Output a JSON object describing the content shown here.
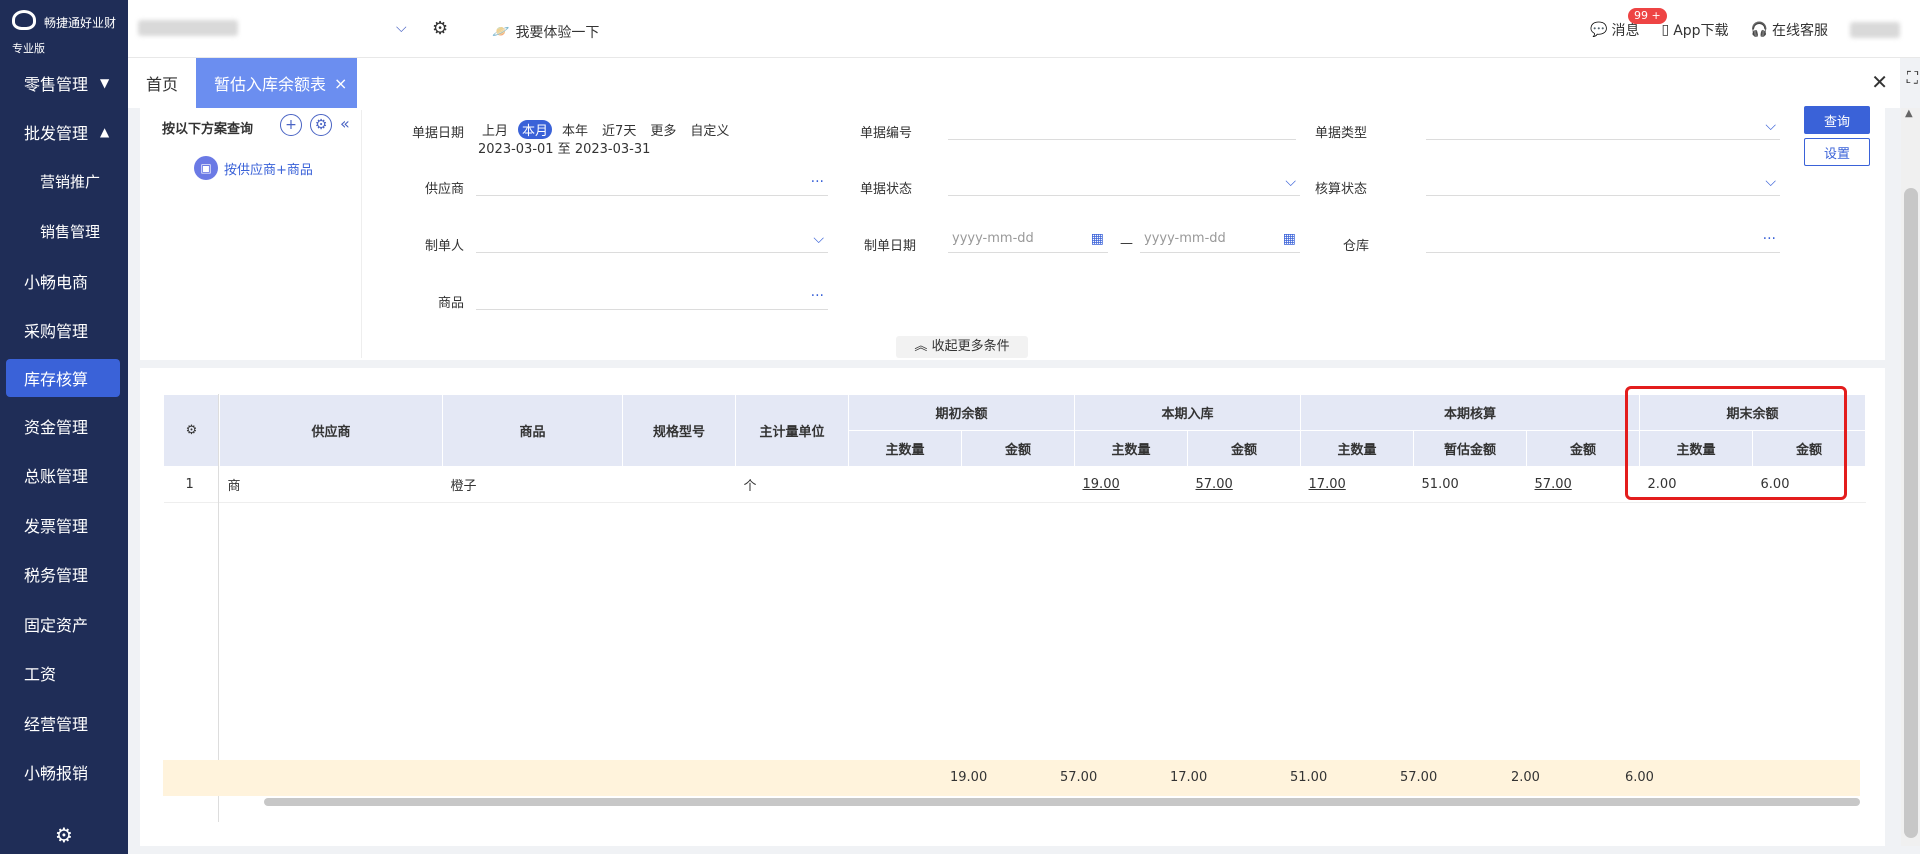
{
  "app": {
    "name": "畅捷通好业财",
    "edition": "专业版"
  },
  "sidebar": {
    "items": [
      {
        "label": "零售管理",
        "arrow": "▼",
        "sub": false,
        "active": false
      },
      {
        "label": "批发管理",
        "arrow": "▲",
        "sub": false,
        "active": false
      },
      {
        "label": "营销推广",
        "arrow": "",
        "sub": true,
        "active": false
      },
      {
        "label": "销售管理",
        "arrow": "",
        "sub": true,
        "active": false
      },
      {
        "label": "小畅电商",
        "arrow": "",
        "sub": false,
        "active": false
      },
      {
        "label": "采购管理",
        "arrow": "",
        "sub": false,
        "active": false
      },
      {
        "label": "库存核算",
        "arrow": "",
        "sub": false,
        "active": true
      },
      {
        "label": "资金管理",
        "arrow": "",
        "sub": false,
        "active": false
      },
      {
        "label": "总账管理",
        "arrow": "",
        "sub": false,
        "active": false
      },
      {
        "label": "发票管理",
        "arrow": "",
        "sub": false,
        "active": false
      },
      {
        "label": "税务管理",
        "arrow": "",
        "sub": false,
        "active": false
      },
      {
        "label": "固定资产",
        "arrow": "",
        "sub": false,
        "active": false
      },
      {
        "label": "工资",
        "arrow": "",
        "sub": false,
        "active": false
      },
      {
        "label": "经营管理",
        "arrow": "",
        "sub": false,
        "active": false
      },
      {
        "label": "小畅报销",
        "arrow": "",
        "sub": false,
        "active": false
      }
    ]
  },
  "topbar": {
    "try_label": "我要体验一下",
    "messages_label": "消息",
    "messages_badge": "99 +",
    "app_download_label": "App下载",
    "online_service_label": "在线客服"
  },
  "tabs": [
    {
      "label": "首页",
      "active": false
    },
    {
      "label": "暂估入库余额表",
      "active": true
    }
  ],
  "filters": {
    "panel_title": "按以下方案查询",
    "scheme_label": "按供应商+商品",
    "doc_date_label": "单据日期",
    "date_tags": [
      "上月",
      "本月",
      "本年",
      "近7天",
      "更多",
      "自定义"
    ],
    "date_active_index": 1,
    "date_range": "2023-03-01 至 2023-03-31",
    "doc_number_label": "单据编号",
    "doc_type_label": "单据类型",
    "supplier_label": "供应商",
    "doc_status_label": "单据状态",
    "accounting_status_label": "核算状态",
    "creator_label": "制单人",
    "create_date_label": "制单日期",
    "date_placeholder_start": "yyyy-mm-dd",
    "date_placeholder_end": "yyyy-mm-dd",
    "date_separator": "—",
    "warehouse_label": "仓库",
    "product_label": "商品",
    "query_button": "查询",
    "settings_button": "设置",
    "collapse_label": "收起更多条件"
  },
  "table": {
    "fixed_headers": [
      "供应商",
      "商品",
      "规格型号",
      "主计量单位"
    ],
    "groups": [
      {
        "label": "期初余额",
        "cols": [
          "主数量",
          "金额"
        ]
      },
      {
        "label": "本期入库",
        "cols": [
          "主数量",
          "金额"
        ]
      },
      {
        "label": "本期核算",
        "cols": [
          "主数量",
          "暂估金额",
          "金额"
        ]
      },
      {
        "label": "期末余额",
        "cols": [
          "主数量",
          "金额"
        ]
      }
    ],
    "rows": [
      {
        "index": "1",
        "supplier": "商",
        "product": "橙子",
        "spec": "",
        "unit": "个",
        "values": [
          "",
          "",
          "19.00",
          "57.00",
          "17.00",
          "51.00",
          "57.00",
          "2.00",
          "6.00"
        ]
      }
    ],
    "totals": [
      "19.00",
      "57.00",
      "17.00",
      "51.00",
      "57.00",
      "2.00",
      "6.00"
    ]
  }
}
